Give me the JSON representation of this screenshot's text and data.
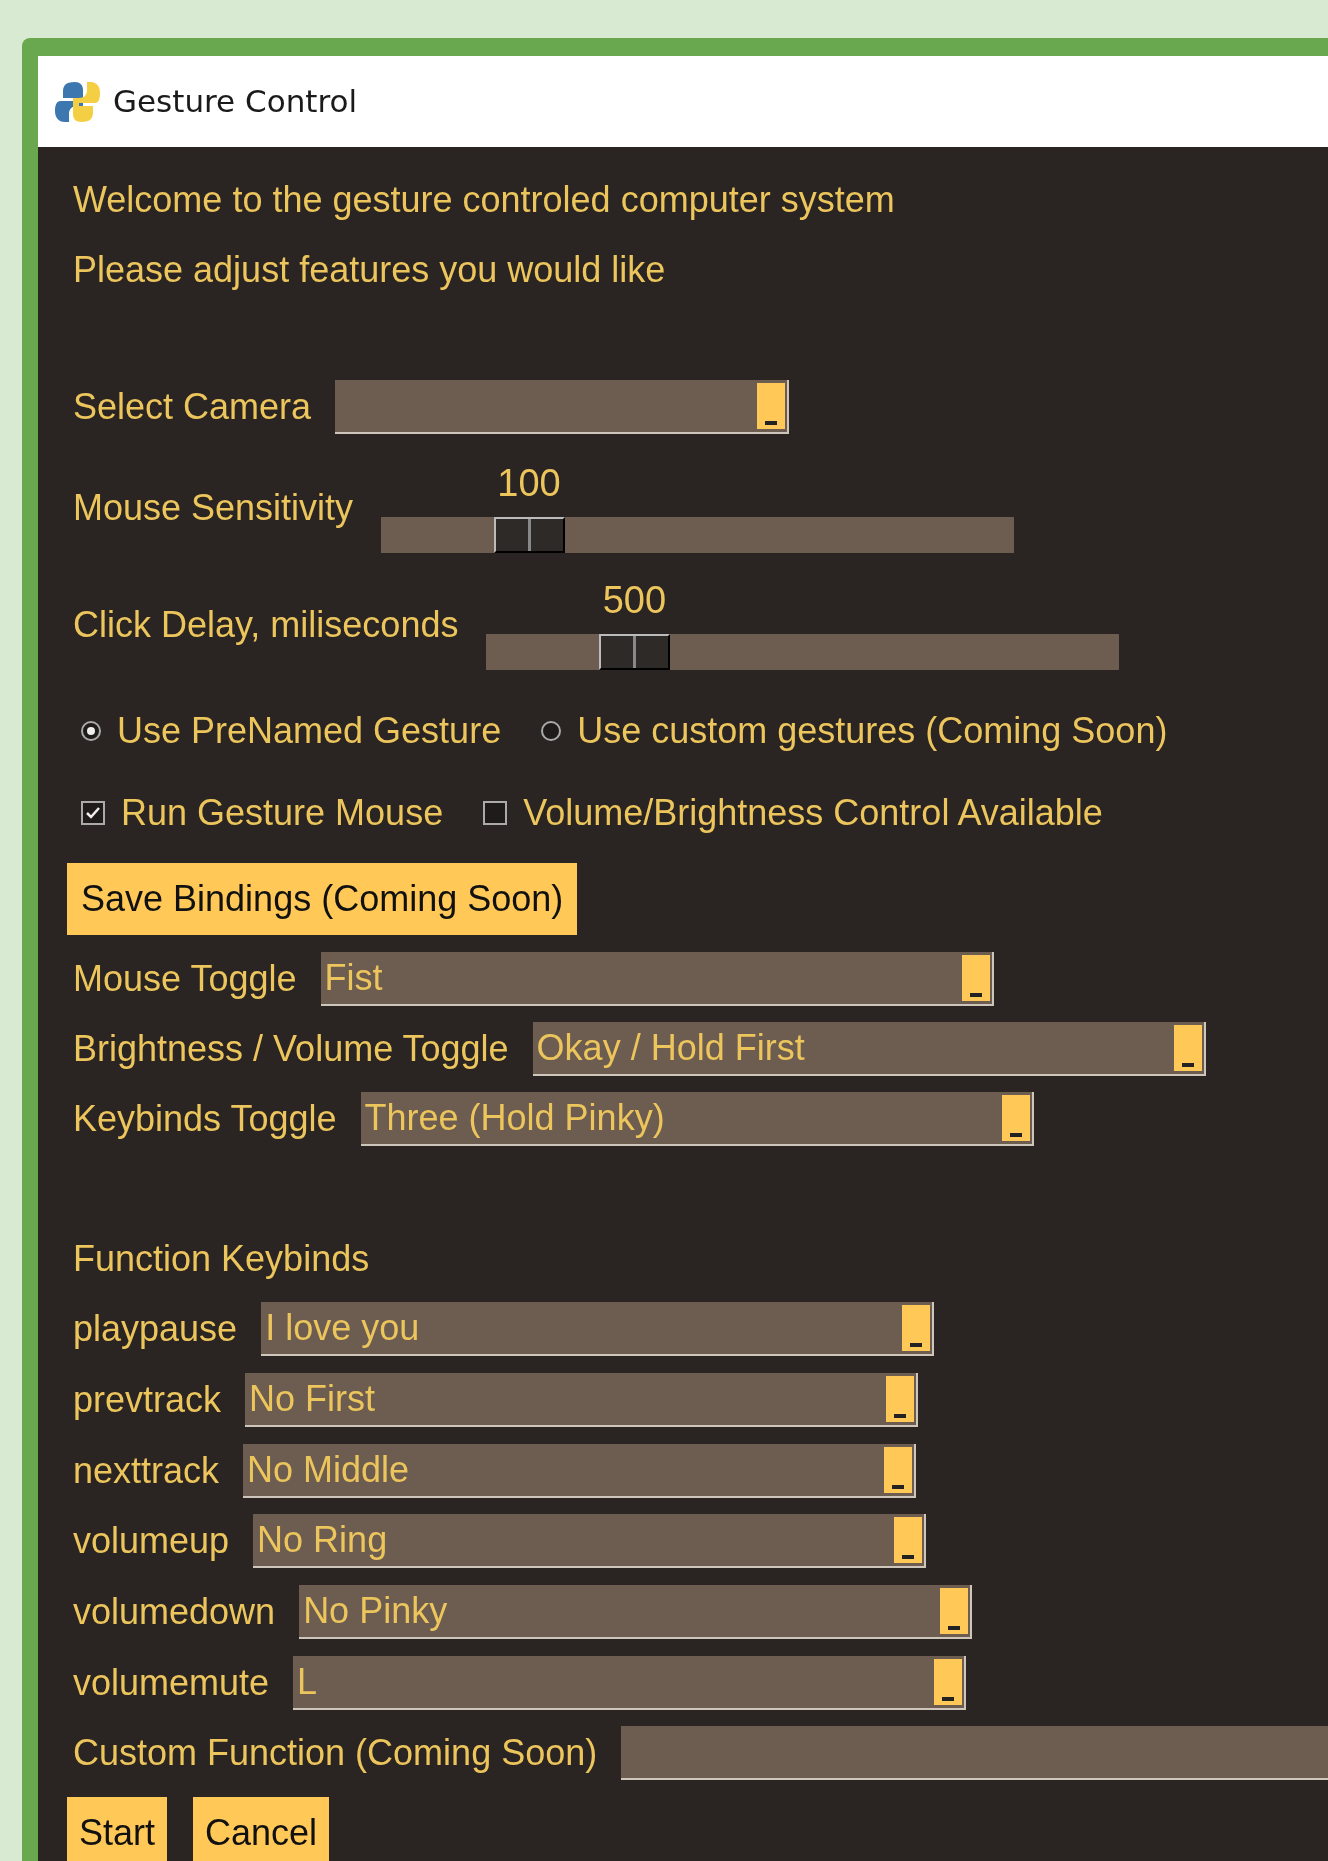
{
  "window": {
    "title": "Gesture Control"
  },
  "intro": [
    "Welcome to the gesture controled computer system",
    "Please adjust features you would like"
  ],
  "camera": {
    "label": "Select Camera"
  },
  "sliders": [
    {
      "label": "Mouse Sensitivity",
      "reading": "100",
      "level": 0.2
    },
    {
      "label": "Click Delay, miliseconds",
      "reading": "500",
      "level": 0.2
    }
  ],
  "radios": [
    {
      "label": "Use PreNamed Gesture",
      "selected": true
    },
    {
      "label": "Use custom gestures (Coming Soon)",
      "selected": false
    }
  ],
  "checkboxes": [
    {
      "label": "Run Gesture Mouse",
      "checked": true
    },
    {
      "label": "Volume/Brightness Control Available",
      "checked": false
    }
  ],
  "save_button": "Save Bindings (Coming Soon)",
  "toggles": [
    {
      "label": "Mouse Toggle",
      "value": "Fist"
    },
    {
      "label": "Brightness / Volume Toggle",
      "value": "Okay / Hold First"
    },
    {
      "label": "Keybinds Toggle",
      "value": "Three (Hold Pinky)"
    }
  ],
  "function_keybinds": {
    "heading": "Function Keybinds",
    "rows": [
      {
        "label": "playpause",
        "value": "I love you"
      },
      {
        "label": "prevtrack",
        "value": "No First"
      },
      {
        "label": "nexttrack",
        "value": "No Middle"
      },
      {
        "label": "volumeup",
        "value": "No Ring"
      },
      {
        "label": "volumedown",
        "value": "No Pinky"
      },
      {
        "label": "volumemute",
        "value": "L"
      }
    ]
  },
  "custom_function": {
    "label": "Custom Function (Coming Soon)"
  },
  "buttons": [
    "Start",
    "Cancel"
  ]
}
